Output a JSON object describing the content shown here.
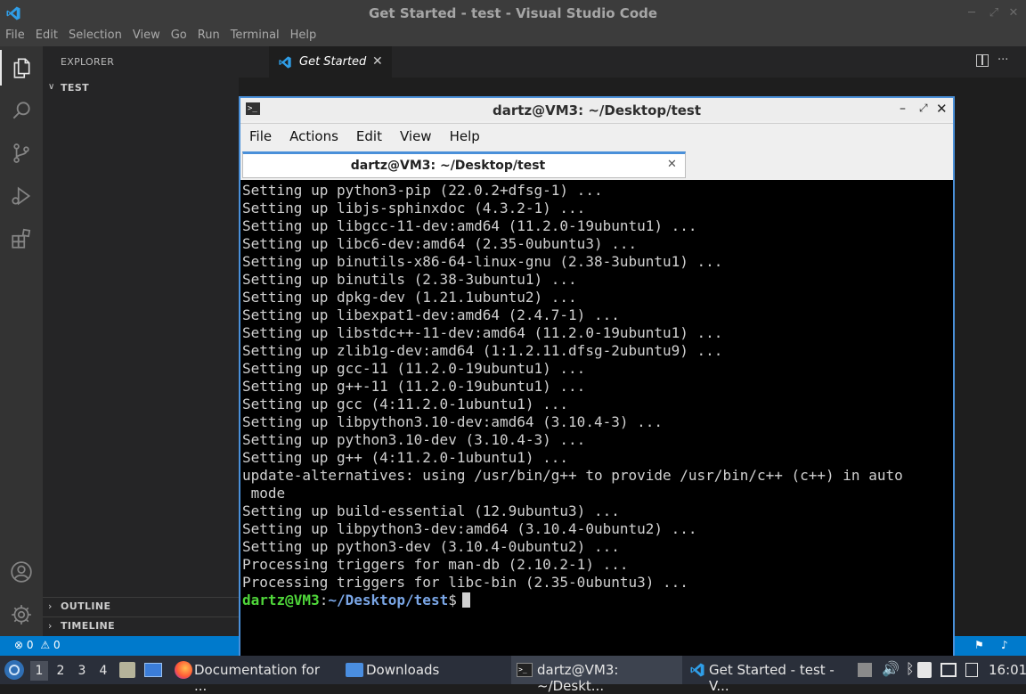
{
  "app": {
    "window_title": "Get Started - test - Visual Studio Code",
    "menu": [
      "File",
      "Edit",
      "Selection",
      "View",
      "Go",
      "Run",
      "Terminal",
      "Help"
    ]
  },
  "sidebar": {
    "header": "EXPLORER",
    "more": "···",
    "folder": "TEST",
    "outline": "OUTLINE",
    "timeline": "TIMELINE"
  },
  "editor": {
    "tab_label": "Get Started",
    "more": "···"
  },
  "statusbar": {
    "errors": "0",
    "warnings": "0"
  },
  "terminal": {
    "title": "dartz@VM3: ~/Desktop/test",
    "menu": [
      "File",
      "Actions",
      "Edit",
      "View",
      "Help"
    ],
    "tab_label": "dartz@VM3: ~/Desktop/test",
    "lines": [
      "Setting up python3-pip (22.0.2+dfsg-1) ...",
      "Setting up libjs-sphinxdoc (4.3.2-1) ...",
      "Setting up libgcc-11-dev:amd64 (11.2.0-19ubuntu1) ...",
      "Setting up libc6-dev:amd64 (2.35-0ubuntu3) ...",
      "Setting up binutils-x86-64-linux-gnu (2.38-3ubuntu1) ...",
      "Setting up binutils (2.38-3ubuntu1) ...",
      "Setting up dpkg-dev (1.21.1ubuntu2) ...",
      "Setting up libexpat1-dev:amd64 (2.4.7-1) ...",
      "Setting up libstdc++-11-dev:amd64 (11.2.0-19ubuntu1) ...",
      "Setting up zlib1g-dev:amd64 (1:1.2.11.dfsg-2ubuntu9) ...",
      "Setting up gcc-11 (11.2.0-19ubuntu1) ...",
      "Setting up g++-11 (11.2.0-19ubuntu1) ...",
      "Setting up gcc (4:11.2.0-1ubuntu1) ...",
      "Setting up libpython3.10-dev:amd64 (3.10.4-3) ...",
      "Setting up python3.10-dev (3.10.4-3) ...",
      "Setting up g++ (4:11.2.0-1ubuntu1) ...",
      "update-alternatives: using /usr/bin/g++ to provide /usr/bin/c++ (c++) in auto",
      " mode",
      "Setting up build-essential (12.9ubuntu3) ...",
      "Setting up libpython3-dev:amd64 (3.10.4-0ubuntu2) ...",
      "Setting up python3-dev (3.10.4-0ubuntu2) ...",
      "Processing triggers for man-db (2.10.2-1) ...",
      "Processing triggers for libc-bin (2.35-0ubuntu3) ..."
    ],
    "prompt_user": "dartz@VM3",
    "prompt_sep": ":",
    "prompt_path": "~/Desktop/test",
    "prompt_symbol": "$"
  },
  "taskbar": {
    "workspaces": [
      "1",
      "2",
      "3",
      "4"
    ],
    "tasks": [
      {
        "label": "Documentation for ...",
        "icon": "firefox-icon"
      },
      {
        "label": "Downloads",
        "icon": "folder-icon"
      },
      {
        "label": "dartz@VM3: ~/Deskt...",
        "icon": "terminal-icon"
      },
      {
        "label": "Get Started - test - V...",
        "icon": "vscode-icon"
      }
    ],
    "clock": "16:01"
  },
  "colors": {
    "vscode_blue": "#007acc",
    "prompt_green": "#4fd63a",
    "prompt_blue": "#7aa6e6",
    "terminal_border": "#4a90d9"
  }
}
